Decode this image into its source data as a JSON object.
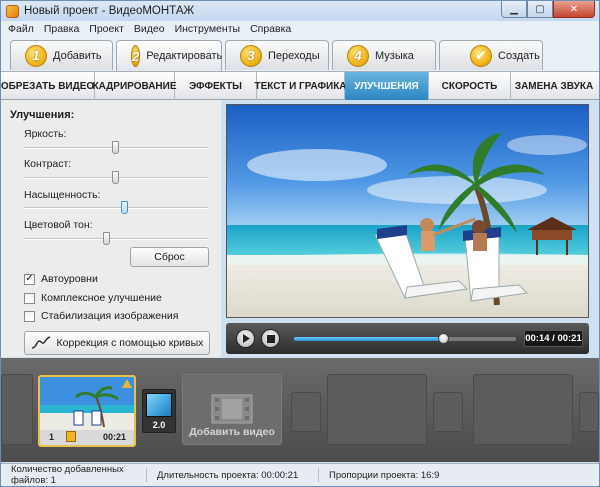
{
  "window": {
    "title": "Новый проект - ВидеоМОНТАЖ"
  },
  "menu": [
    "Файл",
    "Правка",
    "Проект",
    "Видео",
    "Инструменты",
    "Справка"
  ],
  "steps": [
    {
      "num": "1",
      "label": "Добавить"
    },
    {
      "num": "2",
      "label": "Редактировать"
    },
    {
      "num": "3",
      "label": "Переходы"
    },
    {
      "num": "4",
      "label": "Музыка"
    },
    {
      "num": "✔",
      "label": "Создать"
    }
  ],
  "subtabs": [
    "ОБРЕЗАТЬ ВИДЕО",
    "КАДРИРОВАНИЕ",
    "ЭФФЕКТЫ",
    "ТЕКСТ И ГРАФИКА",
    "УЛУЧШЕНИЯ",
    "СКОРОСТЬ",
    "ЗАМЕНА ЗВУКА"
  ],
  "enhance": {
    "title": "Улучшения:",
    "sliders": [
      {
        "label": "Яркость:",
        "value": 0.5
      },
      {
        "label": "Контраст:",
        "value": 0.5
      },
      {
        "label": "Насыщенность:",
        "value": 0.55
      },
      {
        "label": "Цветовой тон:",
        "value": 0.45
      }
    ],
    "reset_label": "Сброс",
    "checks": [
      {
        "label": "Автоуровни",
        "checked": true
      },
      {
        "label": "Комплексное улучшение",
        "checked": false
      },
      {
        "label": "Стабилизация изображения",
        "checked": false
      }
    ],
    "curves_label": "Коррекция с помощью кривых"
  },
  "player": {
    "timecode": "00:14 / 00:21",
    "progress": 0.67
  },
  "timeline": {
    "clip": {
      "index": "1",
      "duration": "00:21"
    },
    "transition": {
      "duration": "2.0"
    },
    "add_video_label": "Добавить видео"
  },
  "status": [
    "Количество добавленных файлов: 1",
    "Длительность проекта:  00:00:21",
    "Пропорции проекта:  16:9"
  ]
}
